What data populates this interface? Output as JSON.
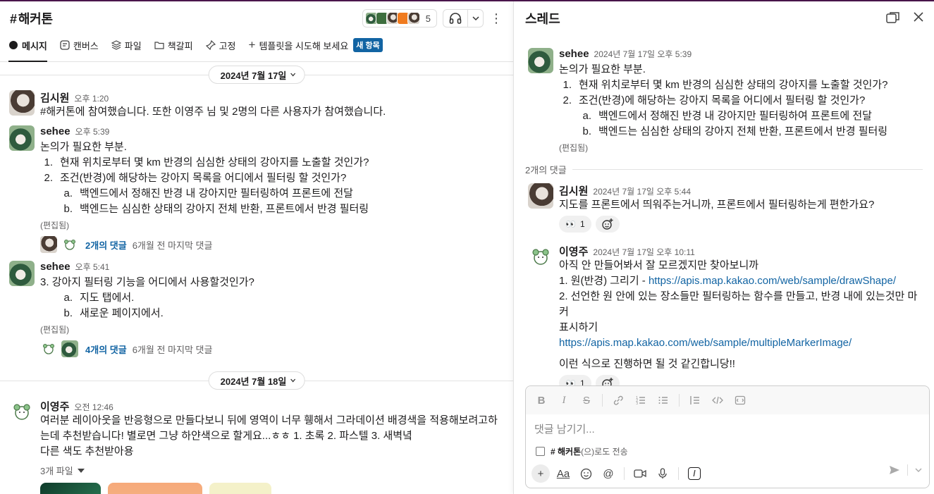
{
  "channel": {
    "hash": "#",
    "name": "해커톤",
    "member_count": "5",
    "tabs": [
      {
        "label": "메시지",
        "icon": "message-icon"
      },
      {
        "label": "캔버스",
        "icon": "canvas-icon"
      },
      {
        "label": "파일",
        "icon": "files-icon"
      },
      {
        "label": "책갈피",
        "icon": "folder-icon"
      },
      {
        "label": "고정",
        "icon": "pin-icon"
      },
      {
        "label": "템플릿을 시도해 보세요",
        "icon": "plus-icon"
      }
    ],
    "new_badge": "새 항목"
  },
  "messages": {
    "date1": "2024년 7월 17일",
    "m1": {
      "author": "김시원",
      "time": "오후 1:20",
      "text": "#해커톤에 참여했습니다. 또한 이영주 님 및 2명의 다른 사용자가 참여했습니다."
    },
    "m2": {
      "author": "sehee",
      "time": "오후 5:39",
      "intro": "논의가 필요한 부분.",
      "items": [
        {
          "num": "1.",
          "text": "현재 위치로부터 몇 km 반경의 심심한 상태의 강아지를 노출할 것인가?"
        },
        {
          "num": "2.",
          "text": "조건(반경)에 해당하는 강아지 목록을 어디에서 필터링 할 것인가?"
        }
      ],
      "subitems": [
        {
          "num": "a.",
          "text": "백엔드에서 정해진 반경 내 강아지만 필터링하여 프론트에 전달"
        },
        {
          "num": "b.",
          "text": "백엔드는 심심한 상태의 강아지 전체 반환, 프론트에서  반경 필터링"
        }
      ],
      "edited": "(편집됨)",
      "replies": "2개의 댓글",
      "last_reply": "6개월 전 마지막 댓글"
    },
    "m3": {
      "author": "sehee",
      "time": "오후 5:41",
      "intro": "3. 강아지 필터링 기능을 어디에서 사용할것인가?",
      "subitems": [
        {
          "num": "a.",
          "text": "지도 탭에서."
        },
        {
          "num": "b.",
          "text": "새로운 페이지에서."
        }
      ],
      "edited": "(편집됨)",
      "replies": "4개의 댓글",
      "last_reply": "6개월 전 마지막 댓글"
    },
    "date2": "2024년 7월 18일",
    "m4": {
      "author": "이영주",
      "time": "오전 12:46",
      "line1": "여러분 레이아웃을 반응형으로 만들다보니 뒤에 영역이 너무 휑해서 그라데이션 배경색을 적용해보려고하",
      "line2": "는데 추천받습니다! 별로면 그냥 하얀색으로 할게요...ㅎㅎ 1. 초록 2. 파스텔 3. 새벽녘",
      "line3": "다른 색도 추천받아용",
      "files_label": "3개 파일"
    }
  },
  "thread": {
    "title": "스레드",
    "root": {
      "author": "sehee",
      "time": "2024년 7월 17일 오후 5:39",
      "intro": "논의가 필요한 부분.",
      "items": [
        {
          "num": "1.",
          "text": "현재 위치로부터 몇 km 반경의 심심한 상태의 강아지를 노출할 것인가?"
        },
        {
          "num": "2.",
          "text": "조건(반경)에 해당하는 강아지 목록을 어디에서 필터링 할 것인가?"
        }
      ],
      "subitems": [
        {
          "num": "a.",
          "text": "백엔드에서 정해진 반경 내 강아지만 필터링하여 프론트에 전달"
        },
        {
          "num": "b.",
          "text": "백엔드는 심심한 상태의 강아지 전체 반환, 프론트에서  반경 필터링"
        }
      ],
      "edited": "(편집됨)"
    },
    "reply_count": "2개의 댓글",
    "r1": {
      "author": "김시원",
      "time": "2024년 7월 17일 오후 5:44",
      "text": "지도를 프론트에서 띄워주는거니까, 프론트에서 필터링하는게 편한가요?",
      "reaction": "👀",
      "reaction_count": "1"
    },
    "r2": {
      "author": "이영주",
      "time": "2024년 7월 17일 오후 10:11",
      "line1": "아직 안 만들어봐서 잘 모르겠지만 찾아보니까",
      "line2_prefix": "1. 원(반경) 그리기 - ",
      "link1": "https://apis.map.kakao.com/web/sample/drawShape/",
      "line3": "2.  선언한 원 안에 있는 장소들만 필터링하는 함수를 만들고, 반경 내에 있는것만 마커",
      "line4": "표시하기",
      "link2": "https://apis.map.kakao.com/web/sample/multipleMarkerImage/",
      "line5": "이런 식으로 진행하면 될 것 같긴합니당!!",
      "reaction": "👀",
      "reaction_count": "1"
    },
    "composer": {
      "placeholder": "댓글 남기기...",
      "also_send_channel": "# 해커톤",
      "also_send_suffix": "(으)로도 전송"
    }
  }
}
